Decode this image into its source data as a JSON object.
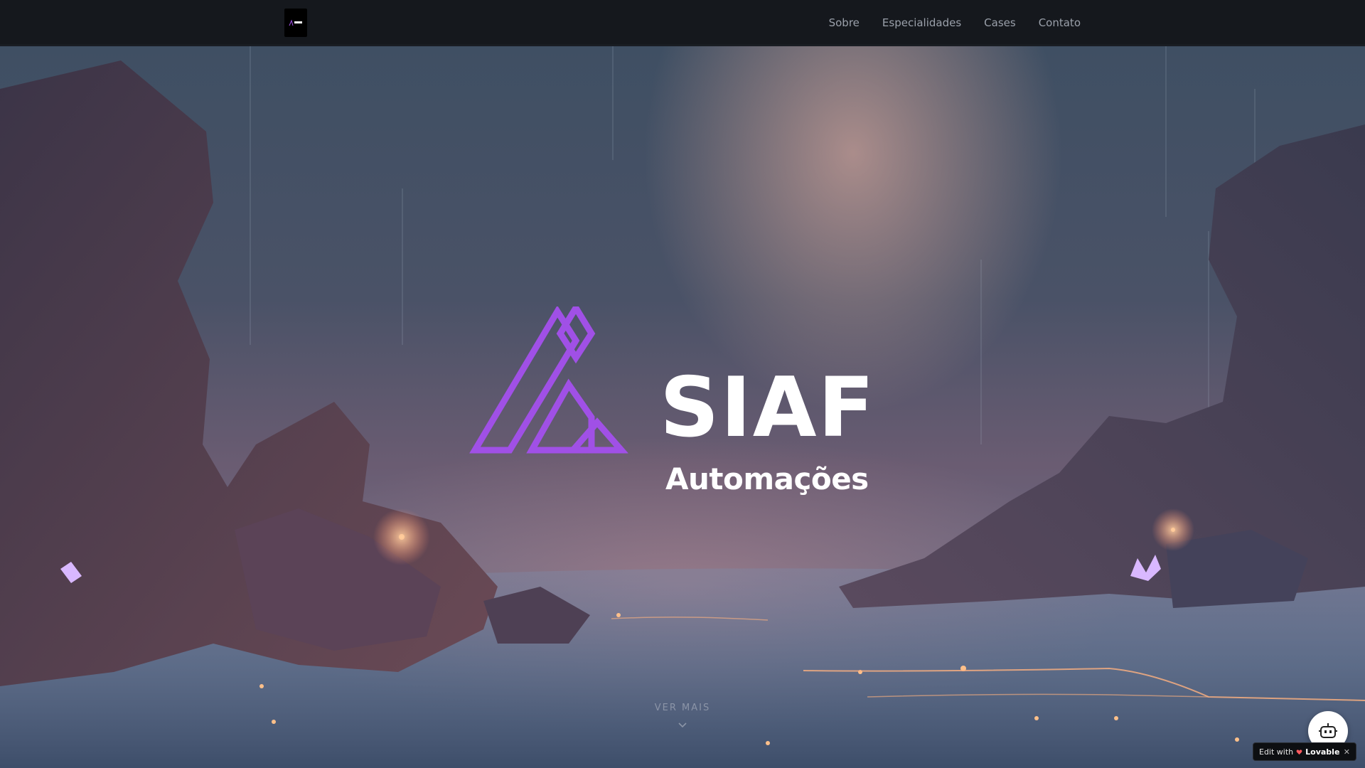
{
  "nav": {
    "links": [
      "Sobre",
      "Especialidades",
      "Cases",
      "Contato"
    ]
  },
  "hero": {
    "title": "SIAF",
    "subtitle": "Automações",
    "scroll_label": "VER MAIS"
  },
  "badge": {
    "edit_with": "Edit with",
    "brand": "Lovable",
    "close": "✕"
  },
  "colors": {
    "brand_purple": "#a050e6",
    "nav_bg": "#15181d",
    "nav_text": "#9aa0aa",
    "lovable_heart": "#ff5a5f"
  },
  "icons": {
    "nav_logo": "siaf-logo-icon",
    "chevron": "chevron-down-icon",
    "bot": "robot-icon",
    "heart": "lovable-heart-icon"
  }
}
